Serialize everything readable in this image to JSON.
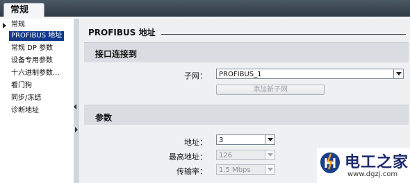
{
  "tabs": {
    "main": "常规"
  },
  "nav": {
    "root": "常规",
    "items": [
      "PROFIBUS 地址",
      "常规 DP 参数",
      "设备专用参数",
      "十六进制参数...",
      "看门狗",
      "同步/冻结",
      "诊断地址"
    ],
    "selected_index": 0
  },
  "page": {
    "title": "PROFIBUS 地址"
  },
  "interface_section": {
    "title": "接口连接到",
    "subnet_label": "子网：",
    "subnet_value": "PROFIBUS_1",
    "add_subnet_button": "添加新子网"
  },
  "params_section": {
    "title": "参数",
    "address_label": "地址：",
    "address_value": "3",
    "highest_address_label": "最高地址：",
    "highest_address_value": "126",
    "baud_rate_label": "传输率：",
    "baud_rate_value": "1.5 Mbps"
  },
  "watermark": {
    "title": "电工之家",
    "url": "www.dgzj.com"
  },
  "colors": {
    "selection": "#123a8a",
    "topbar": "#3a4652",
    "watermark_text": "#1d2a6b"
  }
}
